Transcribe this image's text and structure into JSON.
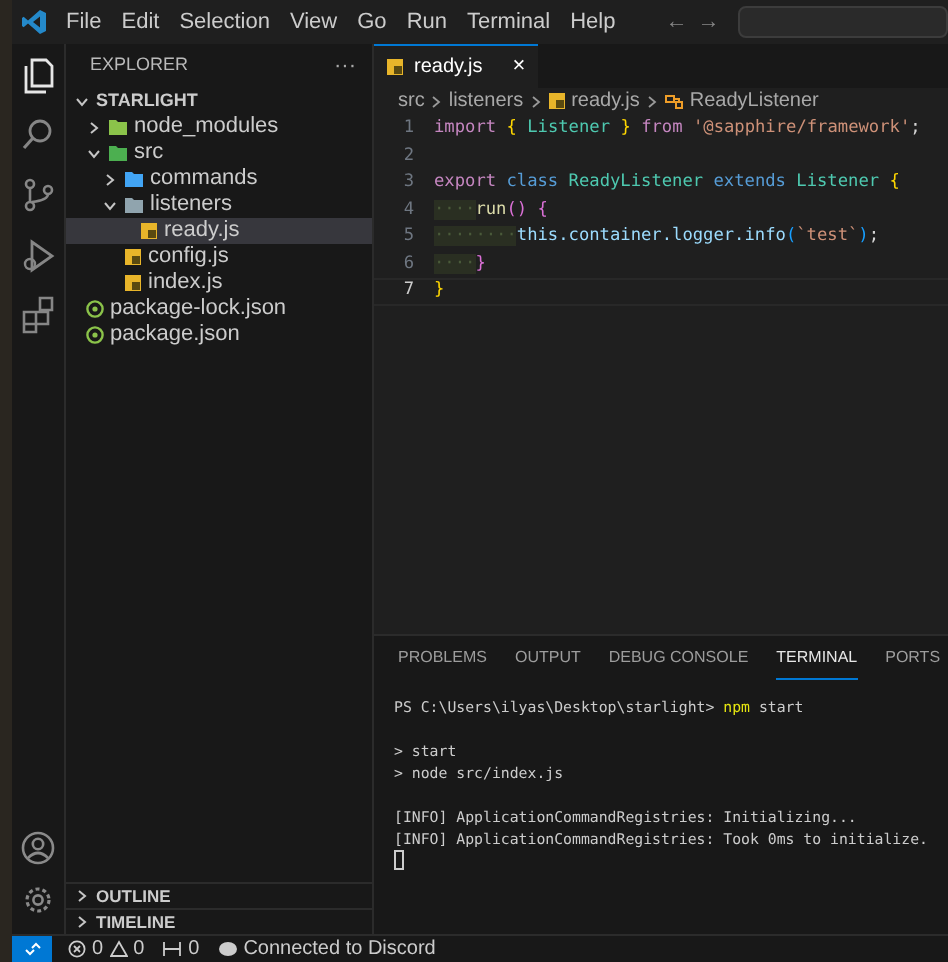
{
  "menu": [
    "File",
    "Edit",
    "Selection",
    "View",
    "Go",
    "Run",
    "Terminal",
    "Help"
  ],
  "navigation": {
    "back": "←",
    "forward": "→"
  },
  "activity_bar": [
    {
      "kind": "explorer",
      "selected": true
    },
    {
      "kind": "search",
      "selected": false
    },
    {
      "kind": "source-control",
      "selected": false
    },
    {
      "kind": "run",
      "selected": false
    },
    {
      "kind": "extensions",
      "selected": false
    }
  ],
  "sidebar": {
    "title": "EXPLORER",
    "more": "···",
    "root": {
      "label": "STARLIGHT",
      "expanded": true
    },
    "tree": [
      {
        "label": "node_modules",
        "kind": "folder",
        "color": "#8bc34a",
        "expanded": false,
        "selected": false
      },
      {
        "label": "src",
        "kind": "folder",
        "color": "#4caf50",
        "expanded": true,
        "selected": false,
        "children": [
          {
            "label": "commands",
            "kind": "folder",
            "color": "#42a5f5",
            "expanded": false,
            "selected": false
          },
          {
            "label": "listeners",
            "kind": "folder",
            "color": "#90a4ae",
            "expanded": true,
            "selected": false,
            "children": [
              {
                "label": "ready.js",
                "kind": "js",
                "selected": true
              }
            ]
          },
          {
            "label": "config.js",
            "kind": "js",
            "selected": false
          },
          {
            "label": "index.js",
            "kind": "js",
            "selected": false
          }
        ]
      },
      {
        "label": "package-lock.json",
        "kind": "json",
        "selected": false
      },
      {
        "label": "package.json",
        "kind": "json",
        "selected": false
      }
    ],
    "sections": [
      {
        "label": "OUTLINE",
        "expanded": false
      },
      {
        "label": "TIMELINE",
        "expanded": false
      }
    ]
  },
  "editor": {
    "tabs": [
      {
        "label": "ready.js",
        "close": "×",
        "selected": true
      }
    ],
    "breadcrumb": [
      "src",
      "listeners",
      "ready.js",
      "ReadyListener"
    ],
    "lines": [
      {
        "number": "1",
        "tokens": [
          {
            "kind": "keyword",
            "text": "import"
          },
          {
            "kind": "brace",
            "text": "{",
            "space": true
          },
          {
            "kind": "type",
            "text": "Listener",
            "space": true
          },
          {
            "kind": "brace",
            "text": "}",
            "space": true
          },
          {
            "kind": "keyword",
            "text": "from",
            "space": true
          },
          {
            "kind": "string",
            "text": "'@sapphire/framework'",
            "space": true
          },
          {
            "kind": "plain",
            "text": ";"
          }
        ]
      },
      {
        "number": "2"
      },
      {
        "number": "3",
        "tokens": [
          {
            "kind": "keyword",
            "text": "export"
          },
          {
            "kind": "storage",
            "text": "class",
            "space": true
          },
          {
            "kind": "type",
            "text": "ReadyListener",
            "space": true
          },
          {
            "kind": "storage",
            "text": "extends",
            "space": true
          },
          {
            "kind": "type",
            "text": "Listener",
            "space": true
          },
          {
            "kind": "brace",
            "text": "{",
            "space": true
          }
        ]
      },
      {
        "number": "4",
        "tokens": [
          {
            "kind": "whitespace",
            "text": "····"
          },
          {
            "kind": "function",
            "text": "run"
          },
          {
            "kind": "brace2",
            "text": "()"
          },
          {
            "kind": "brace2",
            "text": "{",
            "space": true
          }
        ]
      },
      {
        "number": "5",
        "tokens": [
          {
            "kind": "whitespace",
            "text": "········"
          },
          {
            "kind": "variable",
            "text": "this.container.logger.info"
          },
          {
            "kind": "brace3",
            "text": "("
          },
          {
            "kind": "string",
            "text": "`test`"
          },
          {
            "kind": "brace3",
            "text": ")"
          },
          {
            "kind": "plain",
            "text": ";"
          }
        ]
      },
      {
        "number": "6",
        "tokens": [
          {
            "kind": "whitespace",
            "text": "····"
          },
          {
            "kind": "brace2",
            "text": "}"
          }
        ]
      },
      {
        "number": "7",
        "current": true,
        "tokens": [
          {
            "kind": "brace",
            "text": "}"
          }
        ]
      }
    ]
  },
  "panel": {
    "tabs": [
      {
        "label": "PROBLEMS",
        "selected": false
      },
      {
        "label": "OUTPUT",
        "selected": false
      },
      {
        "label": "DEBUG CONSOLE",
        "selected": false
      },
      {
        "label": "TERMINAL",
        "selected": true
      },
      {
        "label": "PORTS",
        "selected": false
      }
    ],
    "terminal": [
      {
        "tokens": [
          {
            "kind": "plain",
            "text": "PS C:\\Users\\ilyas\\Desktop\\starlight>"
          },
          {
            "kind": "command",
            "text": "npm",
            "space": true
          },
          {
            "kind": "plain",
            "text": "start",
            "space": true
          }
        ]
      },
      {
        "blank_before": true,
        "tokens": [
          {
            "kind": "plain",
            "text": "> start"
          }
        ]
      },
      {
        "tokens": [
          {
            "kind": "plain",
            "text": "> node src/index.js"
          }
        ]
      },
      {
        "blank_before": true,
        "tokens": [
          {
            "kind": "plain",
            "text": "[INFO] ApplicationCommandRegistries: Initializing..."
          }
        ]
      },
      {
        "tokens": [
          {
            "kind": "plain",
            "text": "[INFO] ApplicationCommandRegistries: Took 0ms to initialize."
          }
        ]
      }
    ]
  },
  "status_bar": {
    "errors": "0",
    "warnings": "0",
    "ports": "0",
    "discord": "Connected to Discord"
  }
}
